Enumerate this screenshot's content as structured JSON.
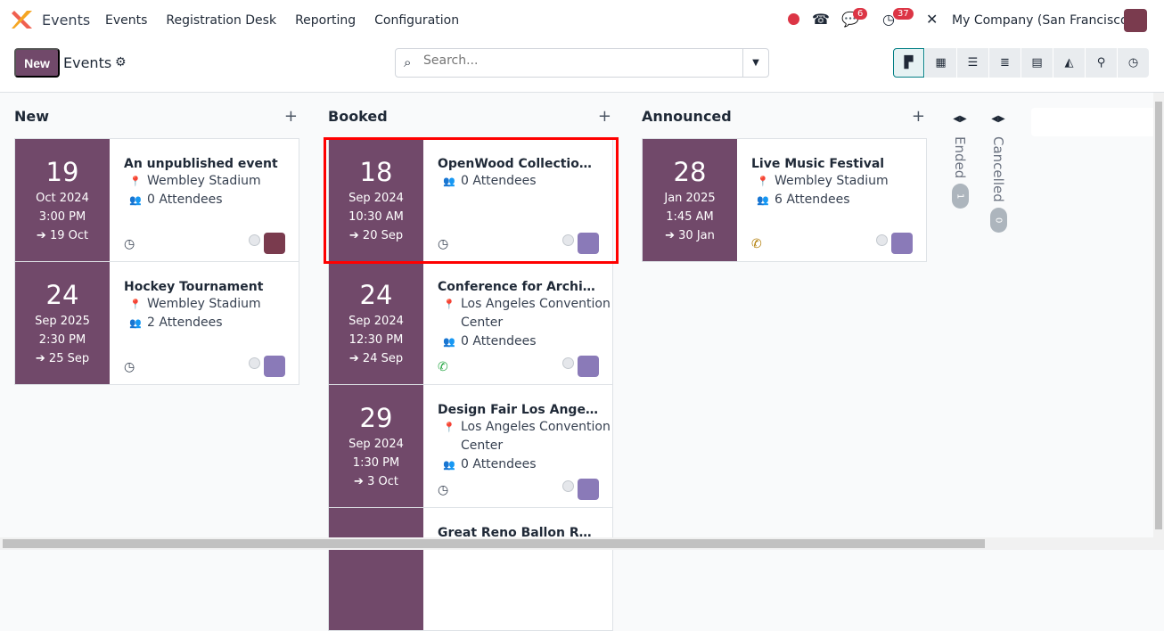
{
  "topbar": {
    "app_name": "Events",
    "menu": [
      "Events",
      "Registration Desk",
      "Reporting",
      "Configuration"
    ],
    "messages_count": "6",
    "activities_count": "37",
    "company": "My Company (San Francisco)"
  },
  "control": {
    "new_label": "New",
    "breadcrumb": "Events",
    "search_placeholder": "Search...",
    "views": [
      "kanban",
      "calendar",
      "list",
      "gantt",
      "pivot",
      "graph",
      "map",
      "activity"
    ],
    "active_view": "kanban"
  },
  "columns": [
    {
      "title": "New",
      "cards": [
        {
          "day": "19",
          "month_year": "Oct 2024",
          "time": "3:00 PM",
          "end": "19 Oct",
          "title": "An unpublished event",
          "location": [
            "Wembley Stadium"
          ],
          "attendees": "0 Attendees",
          "activity_icon": "clock-icon"
        },
        {
          "day": "24",
          "month_year": "Sep 2025",
          "time": "2:30 PM",
          "end": "25 Sep",
          "title": "Hockey Tournament",
          "location": [
            "Wembley Stadium"
          ],
          "attendees": "2 Attendees",
          "activity_icon": "clock-icon"
        }
      ]
    },
    {
      "title": "Booked",
      "cards": [
        {
          "day": "18",
          "month_year": "Sep 2024",
          "time": "10:30 AM",
          "end": "20 Sep",
          "title": "OpenWood Collection ...",
          "location": [],
          "attendees": "0 Attendees",
          "activity_icon": "clock-icon"
        },
        {
          "day": "24",
          "month_year": "Sep 2024",
          "time": "12:30 PM",
          "end": "24 Sep",
          "title": "Conference for Archite...",
          "location": [
            "Los Angeles Convention",
            "Center"
          ],
          "attendees": "0 Attendees",
          "activity_icon": "phone-icon-green"
        },
        {
          "day": "29",
          "month_year": "Sep 2024",
          "time": "1:30 PM",
          "end": "3 Oct",
          "title": "Design Fair Los Angeles",
          "location": [
            "Los Angeles Convention",
            "Center"
          ],
          "attendees": "0 Attendees",
          "activity_icon": "clock-icon"
        },
        {
          "day": "",
          "month_year": "",
          "time": "",
          "end": "",
          "title": "Great Reno Ballon Race",
          "location": [],
          "attendees": "",
          "activity_icon": ""
        }
      ]
    },
    {
      "title": "Announced",
      "cards": [
        {
          "day": "28",
          "month_year": "Jan 2025",
          "time": "1:45 AM",
          "end": "30 Jan",
          "title": "Live Music Festival",
          "location": [
            "Wembley Stadium"
          ],
          "attendees": "6 Attendees",
          "activity_icon": "phone-icon-orange"
        }
      ]
    }
  ],
  "folded": [
    {
      "title": "Ended",
      "count": "1"
    },
    {
      "title": "Cancelled",
      "count": "0"
    }
  ],
  "colors": {
    "brand": "#71496a",
    "accent": "#017e84",
    "badge": "#dc3545",
    "highlight": "#ff0000"
  }
}
